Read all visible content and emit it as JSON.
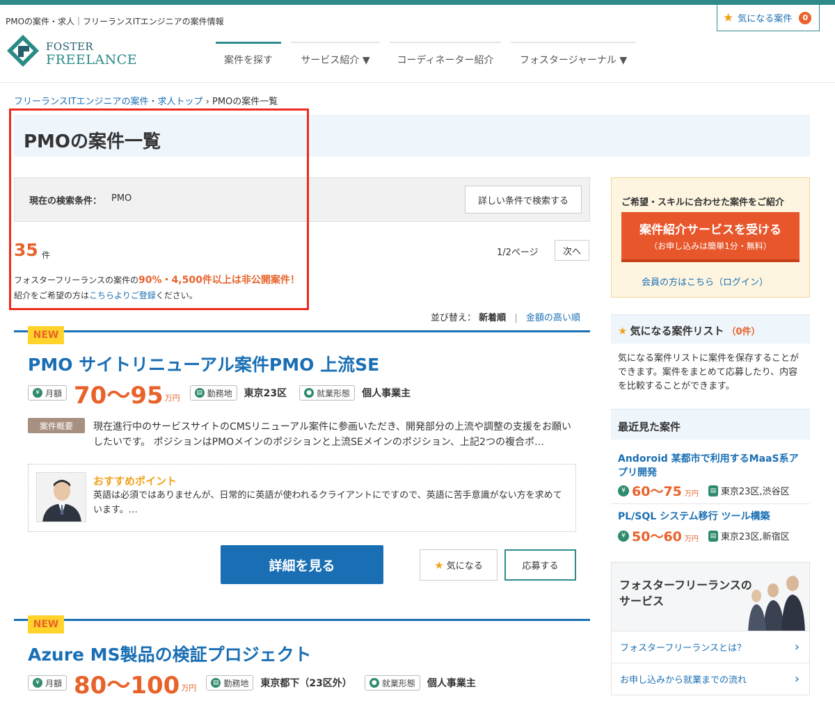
{
  "header": {
    "tagline": "PMOの案件・求人｜フリーランスITエンジニアの案件情報",
    "logo_line1": "FOSTER",
    "logo_line2": "FREELANCE",
    "fav_label": "気になる案件",
    "fav_count": "0",
    "nav": [
      {
        "label": "案件を探す"
      },
      {
        "label": "サービス紹介 ▼"
      },
      {
        "label": "コーディネーター紹介"
      },
      {
        "label": "フォスタージャーナル ▼"
      }
    ]
  },
  "breadcrumb": {
    "home": "フリーランスITエンジニアの案件・求人トップ",
    "sep": " › ",
    "current": "PMOの案件一覧"
  },
  "page_title": "PMOの案件一覧",
  "search": {
    "label": "現在の検索条件：",
    "value": "PMO",
    "detail_button": "詳しい条件で検索する"
  },
  "results": {
    "count": "35",
    "unit": "件",
    "pager": "1/2ページ",
    "next": "次へ",
    "notice_pre": "フォスターフリーランスの案件の",
    "notice_hl": "90%・4,500件以上は非公開案件！",
    "notice2_pre": "紹介をご希望の方は",
    "notice2_link": "こちらよりご登録",
    "notice2_post": "ください。"
  },
  "sort": {
    "label": "並び替え：",
    "newest": "新着順",
    "sep": "|",
    "price": "金額の高い順"
  },
  "jobs": [
    {
      "badge": "NEW",
      "title": "PMO サイトリニューアル案件PMO 上流SE",
      "monthly_label": "月額",
      "price": "70〜95",
      "price_unit": "万円",
      "location_label": "勤務地",
      "location": "東京23区",
      "form_label": "就業形態",
      "form": "個人事業主",
      "summary_label": "案件概要",
      "summary": "現在進行中のサービスサイトのCMSリニューアル案件に参画いただき、開発部分の上流や調整の支援をお願いしたいです。 ポジションはPMOメインのポジションと上流SEメインのポジション、上記2つの複合ポ…",
      "reco_title": "おすすめポイント",
      "reco_text": "英語は必須ではありませんが、日常的に英語が使われるクライアントにですので、英語に苦手意識がない方を求めています。…",
      "detail_button": "詳細を見る",
      "fav_button": "気になる",
      "apply_button": "応募する"
    },
    {
      "badge": "NEW",
      "title": "Azure MS製品の検証プロジェクト",
      "monthly_label": "月額",
      "price": "80〜100",
      "price_unit": "万円",
      "location_label": "勤務地",
      "location": "東京都下（23区外）",
      "form_label": "就業形態",
      "form": "個人事業主"
    }
  ],
  "sidebar": {
    "cta_head": "ご希望・スキルに合わせた案件をご紹介",
    "cta_line1": "案件紹介サービスを受ける",
    "cta_line2": "（お申し込みは簡単1分・無料）",
    "login": "会員の方はこちら（ログイン）",
    "fav_title": "気になる案件リスト",
    "fav_count": "（0件）",
    "fav_desc": "気になる案件リストに案件を保存することができます。案件をまとめて応募したり、内容を比較することができます。",
    "recent_title": "最近見た案件",
    "recent": [
      {
        "title": "Andoroid 某都市で利用するMaaS系アプリ開発",
        "price": "60〜75",
        "unit": "万円",
        "location": "東京23区,渋谷区"
      },
      {
        "title": "PL/SQL システム移行 ツール構築",
        "price": "50〜60",
        "unit": "万円",
        "location": "東京23区,新宿区"
      }
    ],
    "service_title": "フォスターフリーランスのサービス",
    "links": [
      {
        "label": "フォスターフリーランスとは？"
      },
      {
        "label": "お申し込みから就業までの流れ"
      }
    ]
  },
  "colors": {
    "accent_teal": "#2f8a8a",
    "link_blue": "#1a6fb4",
    "orange": "#e8632b",
    "highlight_frame": "#ee2b1e"
  }
}
